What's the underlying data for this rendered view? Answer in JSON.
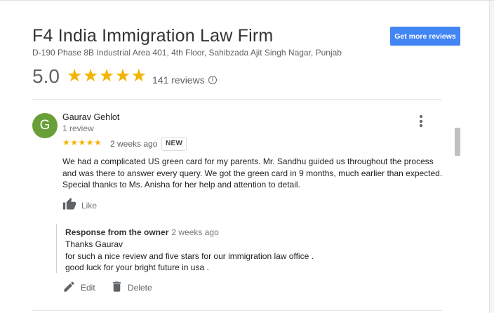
{
  "business": {
    "name": "F4 India Immigration Law Firm",
    "address": "D-190 Phase 8B Industrial Area 401, 4th Floor, Sahibzada Ajit Singh Nagar, Punjab",
    "get_more_reviews_label": "Get more reviews"
  },
  "rating": {
    "value": "5.0",
    "stars": "★★★★★",
    "star_count": 5,
    "review_count_text": "141 reviews",
    "info_icon_glyph": "i"
  },
  "review": {
    "avatar_letter": "G",
    "avatar_color": "#689f38",
    "reviewer_name": "Gaurav Gehlot",
    "reviewer_meta": "1 review",
    "stars": "★★★★★",
    "star_count": 5,
    "age": "2 weeks ago",
    "badge": "NEW",
    "text": "We had a complicated US green card for my parents. Mr. Sandhu guided us throughout the process and was there to answer every query. We got the green card in 9 months, much earlier than expected. Special thanks to Ms. Anisha for her help and attention to detail.",
    "like_label": "Like"
  },
  "owner_response": {
    "label": "Response from the owner",
    "age": "2 weeks ago",
    "lines": [
      "Thanks Gaurav",
      "for such a nice review and five stars for our immigration law office .",
      "good luck for your bright future in usa ."
    ]
  },
  "actions": {
    "edit_label": "Edit",
    "delete_label": "Delete"
  },
  "colors": {
    "accent_button": "#4285f4",
    "star": "#f4b400"
  },
  "icons": [
    "info-icon",
    "more-vert-icon",
    "thumbs-up-icon",
    "pencil-icon",
    "trash-icon"
  ]
}
